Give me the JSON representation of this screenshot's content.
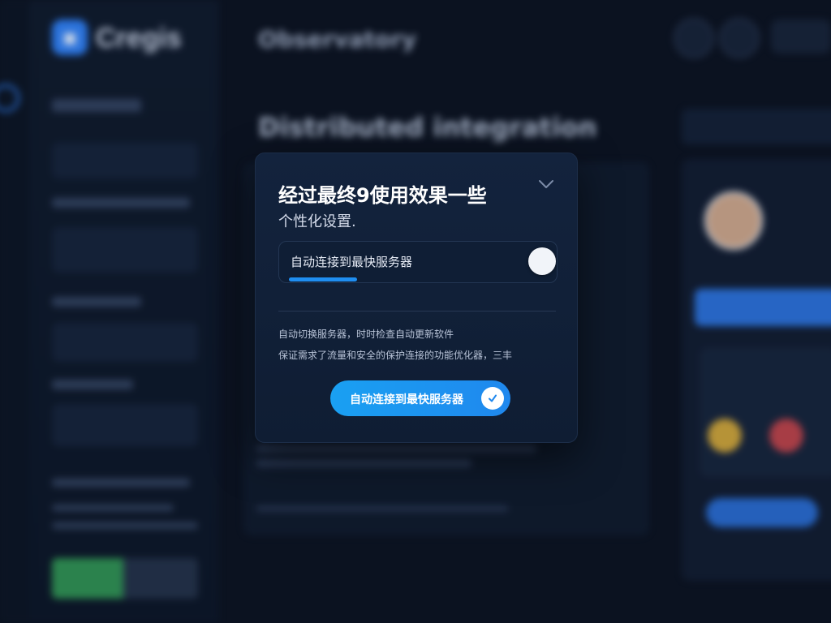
{
  "background": {
    "app_name": "Cregis",
    "header_title": "Observatory",
    "main_heading": "Distributed integration"
  },
  "dialog": {
    "title": "经过最终9使用效果一些",
    "subtitle": "个性化设置.",
    "toggle": {
      "label": "自动连接到最快服务器",
      "progress": 0.28
    },
    "description_lines": [
      "自动切换服务器，时时检查自动更新软件",
      "保证需求了流量和安全的保护连接的功能优化器，三丰"
    ],
    "primary_button_label": "自动连接到最快服务器",
    "icons": {
      "collapse": "chevron-down-icon",
      "button": "checkmark-icon"
    }
  },
  "colors": {
    "accent": "#1f8ef1",
    "dialog_bg": "#13233d",
    "page_bg": "#0b1220"
  }
}
